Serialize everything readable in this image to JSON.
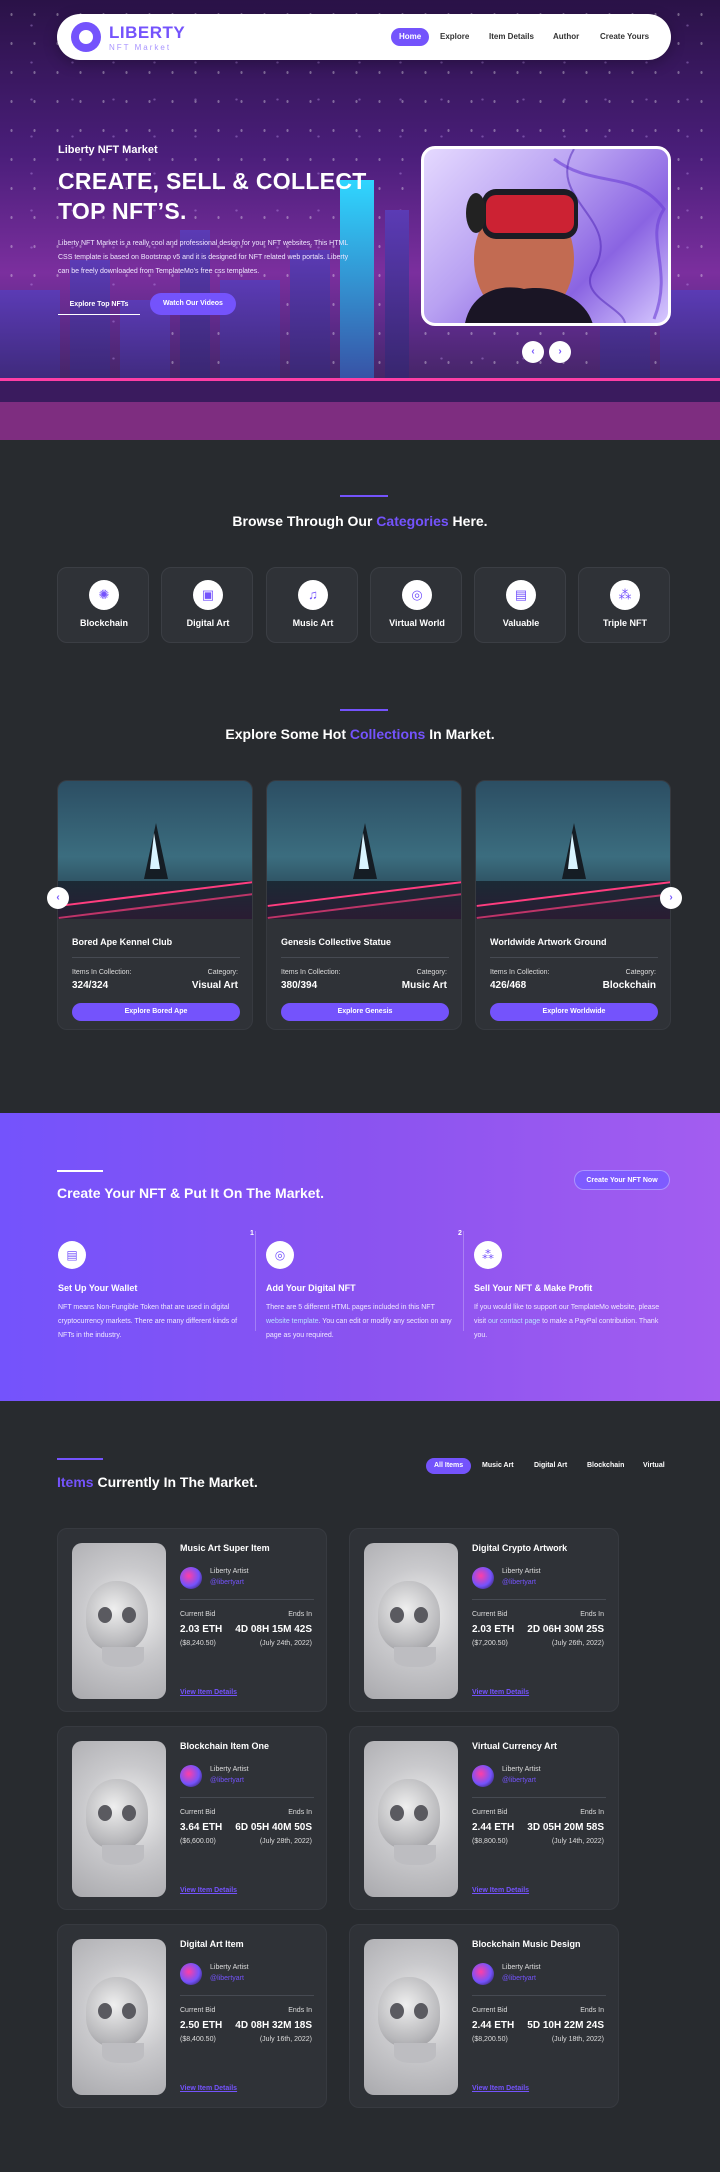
{
  "brand": {
    "title": "LIBERTY",
    "subtitle": "NFT Market"
  },
  "nav": {
    "items": [
      "Home",
      "Explore",
      "Item Details",
      "Author",
      "Create Yours"
    ]
  },
  "hero": {
    "kicker": "Liberty NFT Market",
    "title": "CREATE, SELL & COLLECT TOP NFT’S.",
    "description": "Liberty NFT Market is a really cool and professional design for your NFT websites. This HTML CSS template is based on Bootstrap v5 and it is designed for NFT related web portals. Liberty can be freely downloaded from TemplateMo's free css templates.",
    "btn_explore": "Explore Top NFTs",
    "btn_video": "Watch Our Videos",
    "prev": "‹",
    "next": "›"
  },
  "categories": {
    "title_a": "Browse Through Our ",
    "title_hl": "Categories",
    "title_b": " Here.",
    "items": [
      {
        "label": "Blockchain",
        "icon": "network-icon"
      },
      {
        "label": "Digital Art",
        "icon": "image-icon"
      },
      {
        "label": "Music Art",
        "icon": "music-icon"
      },
      {
        "label": "Virtual World",
        "icon": "globe-icon"
      },
      {
        "label": "Valuable",
        "icon": "wallet-icon"
      },
      {
        "label": "Triple NFT",
        "icon": "nodes-icon"
      }
    ]
  },
  "collections": {
    "title_a": "Explore Some Hot ",
    "title_hl": "Collections",
    "title_b": " In Market.",
    "items_label": "Items In Collection:",
    "category_label": "Category:",
    "items": [
      {
        "name": "Bored Ape Kennel Club",
        "count": "324/324",
        "category": "Visual Art",
        "button": "Explore Bored Ape"
      },
      {
        "name": "Genesis Collective Statue",
        "count": "380/394",
        "category": "Music Art",
        "button": "Explore Genesis"
      },
      {
        "name": "Worldwide Artwork Ground",
        "count": "426/468",
        "category": "Blockchain",
        "button": "Explore Worldwide"
      }
    ]
  },
  "create": {
    "title": "Create Your NFT & Put It On The Market.",
    "button": "Create Your NFT Now",
    "steps": [
      {
        "num": "",
        "title": "Set Up Your Wallet",
        "desc": "NFT means Non-Fungible Token that are used in digital cryptocurrency markets. There are many different kinds of NFTs in the industry."
      },
      {
        "num": "1",
        "title": "Add Your Digital NFT",
        "desc_a": "There are 5 different HTML pages included in this NFT ",
        "desc_link": "website template",
        "desc_b": ". You can edit or modify any section on any page as you required."
      },
      {
        "num": "2",
        "title": "Sell Your NFT & Make Profit",
        "desc_a": "If you would like to support our TemplateMo website, please visit ",
        "desc_link": "our contact page",
        "desc_b": " to make a PayPal contribution. Thank you."
      }
    ]
  },
  "market": {
    "title_hl": "Items",
    "title_b": " Currently In The Market.",
    "filters": [
      "All Items",
      "Music Art",
      "Digital Art",
      "Blockchain",
      "Virtual"
    ],
    "bid_label": "Current Bid",
    "ends_label": "Ends In",
    "link": "View Item Details",
    "items": [
      {
        "title": "Music Art Super Item",
        "artist": "Liberty Artist",
        "handle": "@libertyart",
        "bid": "2.03 ETH",
        "usd": "($8,240.50)",
        "ends": "4D 08H 15M 42S",
        "date": "(July 24th, 2022)"
      },
      {
        "title": "Digital Crypto Artwork",
        "artist": "Liberty Artist",
        "handle": "@libertyart",
        "bid": "2.03 ETH",
        "usd": "($7,200.50)",
        "ends": "2D 06H 30M 25S",
        "date": "(July 26th, 2022)"
      },
      {
        "title": "Blockchain Item One",
        "artist": "Liberty Artist",
        "handle": "@libertyart",
        "bid": "3.64 ETH",
        "usd": "($6,600.00)",
        "ends": "6D 05H 40M 50S",
        "date": "(July 28th, 2022)"
      },
      {
        "title": "Virtual Currency Art",
        "artist": "Liberty Artist",
        "handle": "@libertyart",
        "bid": "2.44 ETH",
        "usd": "($8,800.50)",
        "ends": "3D 05H 20M 58S",
        "date": "(July 14th, 2022)"
      },
      {
        "title": "Digital Art Item",
        "artist": "Liberty Artist",
        "handle": "@libertyart",
        "bid": "2.50 ETH",
        "usd": "($8,400.50)",
        "ends": "4D 08H 32M 18S",
        "date": "(July 16th, 2022)"
      },
      {
        "title": "Blockchain Music Design",
        "artist": "Liberty Artist",
        "handle": "@libertyart",
        "bid": "2.44 ETH",
        "usd": "($8,200.50)",
        "ends": "5D 10H 22M 24S",
        "date": "(July 18th, 2022)"
      }
    ]
  },
  "colors": {
    "accent": "#7453fc",
    "bg": "#282b2f",
    "card": "#2f3237"
  }
}
